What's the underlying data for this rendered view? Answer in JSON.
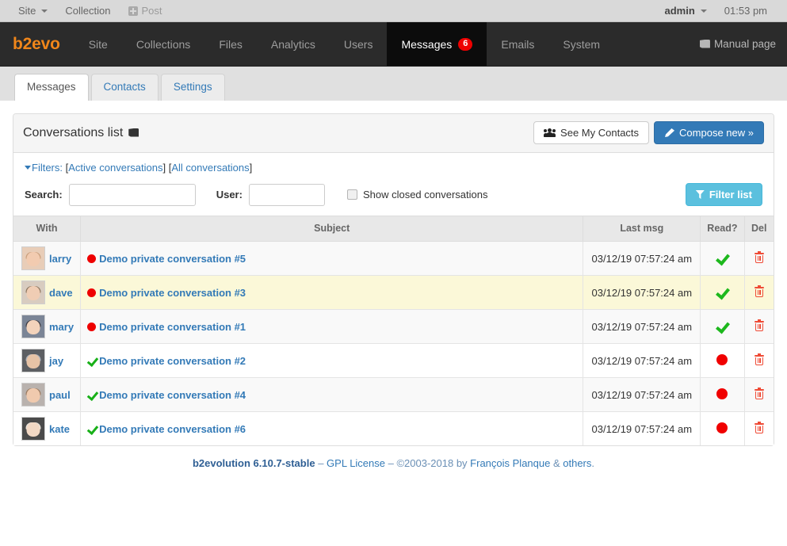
{
  "evobar": {
    "site_label": "Site",
    "collection_label": "Collection",
    "post_label": "Post",
    "user_label": "admin",
    "time": "01:53 pm"
  },
  "mainnav": {
    "brand": "b2evo",
    "items": [
      {
        "label": "Site",
        "active": false
      },
      {
        "label": "Collections",
        "active": false
      },
      {
        "label": "Files",
        "active": false
      },
      {
        "label": "Analytics",
        "active": false
      },
      {
        "label": "Users",
        "active": false
      },
      {
        "label": "Messages",
        "active": true,
        "badge": "6"
      },
      {
        "label": "Emails",
        "active": false
      },
      {
        "label": "System",
        "active": false
      }
    ],
    "manual_label": "Manual page"
  },
  "tabs": [
    {
      "label": "Messages",
      "active": true
    },
    {
      "label": "Contacts",
      "active": false
    },
    {
      "label": "Settings",
      "active": false
    }
  ],
  "panel": {
    "title": "Conversations list",
    "see_contacts_label": "See My Contacts",
    "compose_label": "Compose new »"
  },
  "filters": {
    "label": "Filters:",
    "open_bracket": "[",
    "close_bracket": "]",
    "active_link": "Active conversations",
    "all_link": "All conversations",
    "search_label": "Search:",
    "search_value": "",
    "search_placeholder": "",
    "user_label": "User:",
    "user_value": "",
    "user_placeholder": "",
    "show_closed_label": "Show closed conversations",
    "show_closed_checked": false,
    "filter_button_label": "Filter list"
  },
  "table": {
    "columns": [
      "With",
      "Subject",
      "Last msg",
      "Read?",
      "Del"
    ],
    "rows": [
      {
        "user": "larry",
        "subject": "Demo private conversation #5",
        "status": "unread-dot",
        "last_msg": "03/12/19 07:57:24 am",
        "read": "check",
        "del": "trash-icon",
        "row_style": "odd",
        "avatar": {
          "bg": "#e8cdb8",
          "face": "#f2cbb0",
          "hair": "#caa07e"
        }
      },
      {
        "user": "dave",
        "subject": "Demo private conversation #3",
        "status": "unread-dot",
        "last_msg": "03/12/19 07:57:24 am",
        "read": "check",
        "del": "trash-icon",
        "row_style": "hl",
        "avatar": {
          "bg": "#d8ccc0",
          "face": "#f0cdb4",
          "hair": "#8d7760"
        }
      },
      {
        "user": "mary",
        "subject": "Demo private conversation #1",
        "status": "unread-dot",
        "last_msg": "03/12/19 07:57:24 am",
        "read": "check",
        "del": "trash-icon",
        "row_style": "odd",
        "avatar": {
          "bg": "#7b8596",
          "face": "#f3d3bb",
          "hair": "#3d3d45"
        }
      },
      {
        "user": "jay",
        "subject": "Demo private conversation #2",
        "status": "read-check",
        "last_msg": "03/12/19 07:57:24 am",
        "read": "dot",
        "del": "trash-icon",
        "row_style": "even",
        "avatar": {
          "bg": "#5d5f63",
          "face": "#e7c3a6",
          "hair": "#a9b0bb"
        }
      },
      {
        "user": "paul",
        "subject": "Demo private conversation #4",
        "status": "read-check",
        "last_msg": "03/12/19 07:57:24 am",
        "read": "dot",
        "del": "trash-icon",
        "row_style": "odd",
        "avatar": {
          "bg": "#b9b2ae",
          "face": "#f0caae",
          "hair": "#9b7c62"
        }
      },
      {
        "user": "kate",
        "subject": "Demo private conversation #6",
        "status": "read-check",
        "last_msg": "03/12/19 07:57:24 am",
        "read": "dot",
        "del": "trash-icon",
        "row_style": "even",
        "avatar": {
          "bg": "#4a4a4a",
          "face": "#f2d8c4",
          "hair": "#e9e4dd"
        }
      }
    ]
  },
  "footer": {
    "version": "b2evolution 6.10.7-stable",
    "sep1": " – ",
    "license": "GPL License",
    "sep2": " – ",
    "copyright": "©2003-2018 by ",
    "author": "François Planque",
    "amp": " & ",
    "others": "others",
    "period": "."
  },
  "colors": {
    "brand_orange": "#f0861a",
    "link_blue": "#337ab7",
    "badge_red": "#ee0000",
    "check_green": "#18b018",
    "trash_red": "#ef4b36",
    "highlight_row": "#fbf8d8",
    "info_blue": "#5bc0de"
  }
}
